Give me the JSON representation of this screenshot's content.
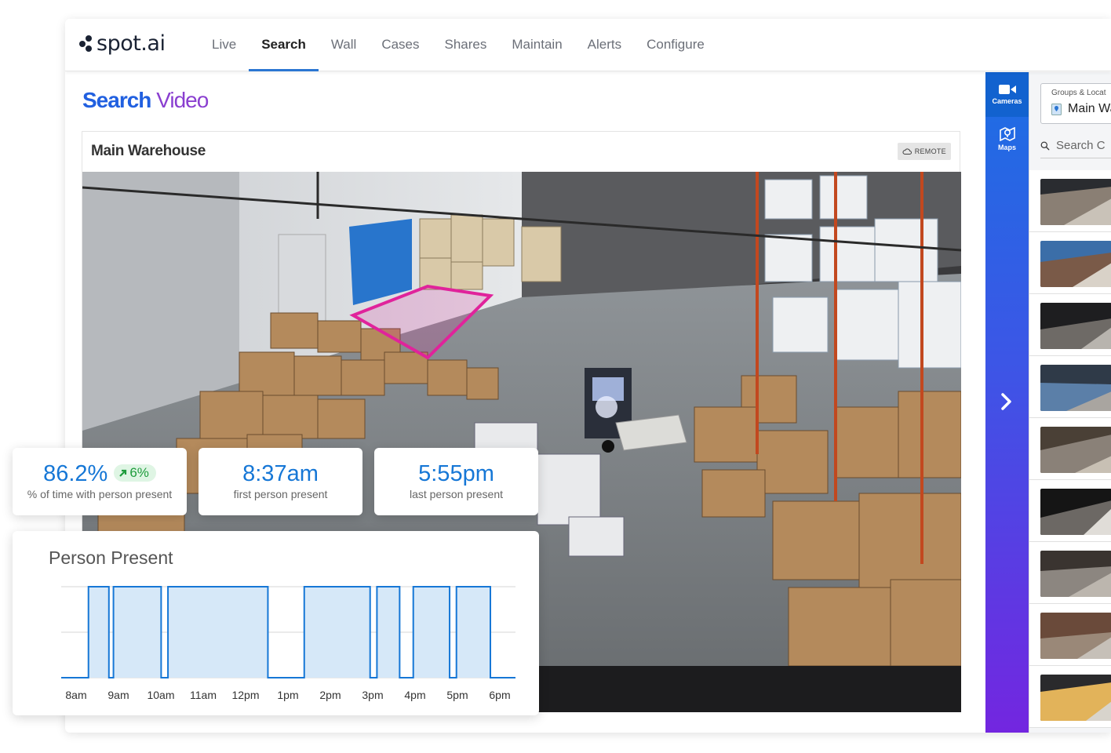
{
  "brand": {
    "name": "spot.ai"
  },
  "nav": {
    "items": [
      {
        "label": "Live",
        "active": false
      },
      {
        "label": "Search",
        "active": true
      },
      {
        "label": "Wall",
        "active": false
      },
      {
        "label": "Cases",
        "active": false
      },
      {
        "label": "Shares",
        "active": false
      },
      {
        "label": "Maintain",
        "active": false
      },
      {
        "label": "Alerts",
        "active": false
      },
      {
        "label": "Configure",
        "active": false
      }
    ]
  },
  "page": {
    "title_part1": "Search",
    "title_part2": "Video"
  },
  "camera": {
    "name": "Main Warehouse",
    "badge": "REMOTE",
    "region_color": "#e0239b"
  },
  "rail": {
    "cameras_label": "Cameras",
    "maps_label": "Maps",
    "expand_icon": "chevron-right-icon"
  },
  "side_panel": {
    "group_label": "Groups & Locat",
    "group_value": "Main Wa",
    "search_placeholder": "Search C",
    "thumbnail_count": 9
  },
  "stats": [
    {
      "value": "86.2%",
      "label": "% of time with person present",
      "trend": "6%",
      "trend_direction": "up"
    },
    {
      "value": "8:37am",
      "label": "first person present"
    },
    {
      "value": "5:55pm",
      "label": "last person present"
    }
  ],
  "chart_data": {
    "type": "area",
    "title": "Person Present",
    "x_ticks": [
      "8am",
      "9am",
      "10am",
      "11am",
      "12pm",
      "1pm",
      "2pm",
      "3pm",
      "4pm",
      "5pm",
      "6pm"
    ],
    "xlim": [
      8,
      18
    ],
    "ylim": [
      0,
      1
    ],
    "grid": true,
    "color": "#1677d6",
    "fill": "#d6e8f8",
    "intervals": [
      {
        "start": 8.6,
        "end": 9.05
      },
      {
        "start": 9.15,
        "end": 10.2
      },
      {
        "start": 10.35,
        "end": 12.55
      },
      {
        "start": 13.35,
        "end": 14.8
      },
      {
        "start": 14.95,
        "end": 15.45
      },
      {
        "start": 15.75,
        "end": 16.55
      },
      {
        "start": 16.7,
        "end": 18.3
      }
    ],
    "series_shape": "binary"
  }
}
